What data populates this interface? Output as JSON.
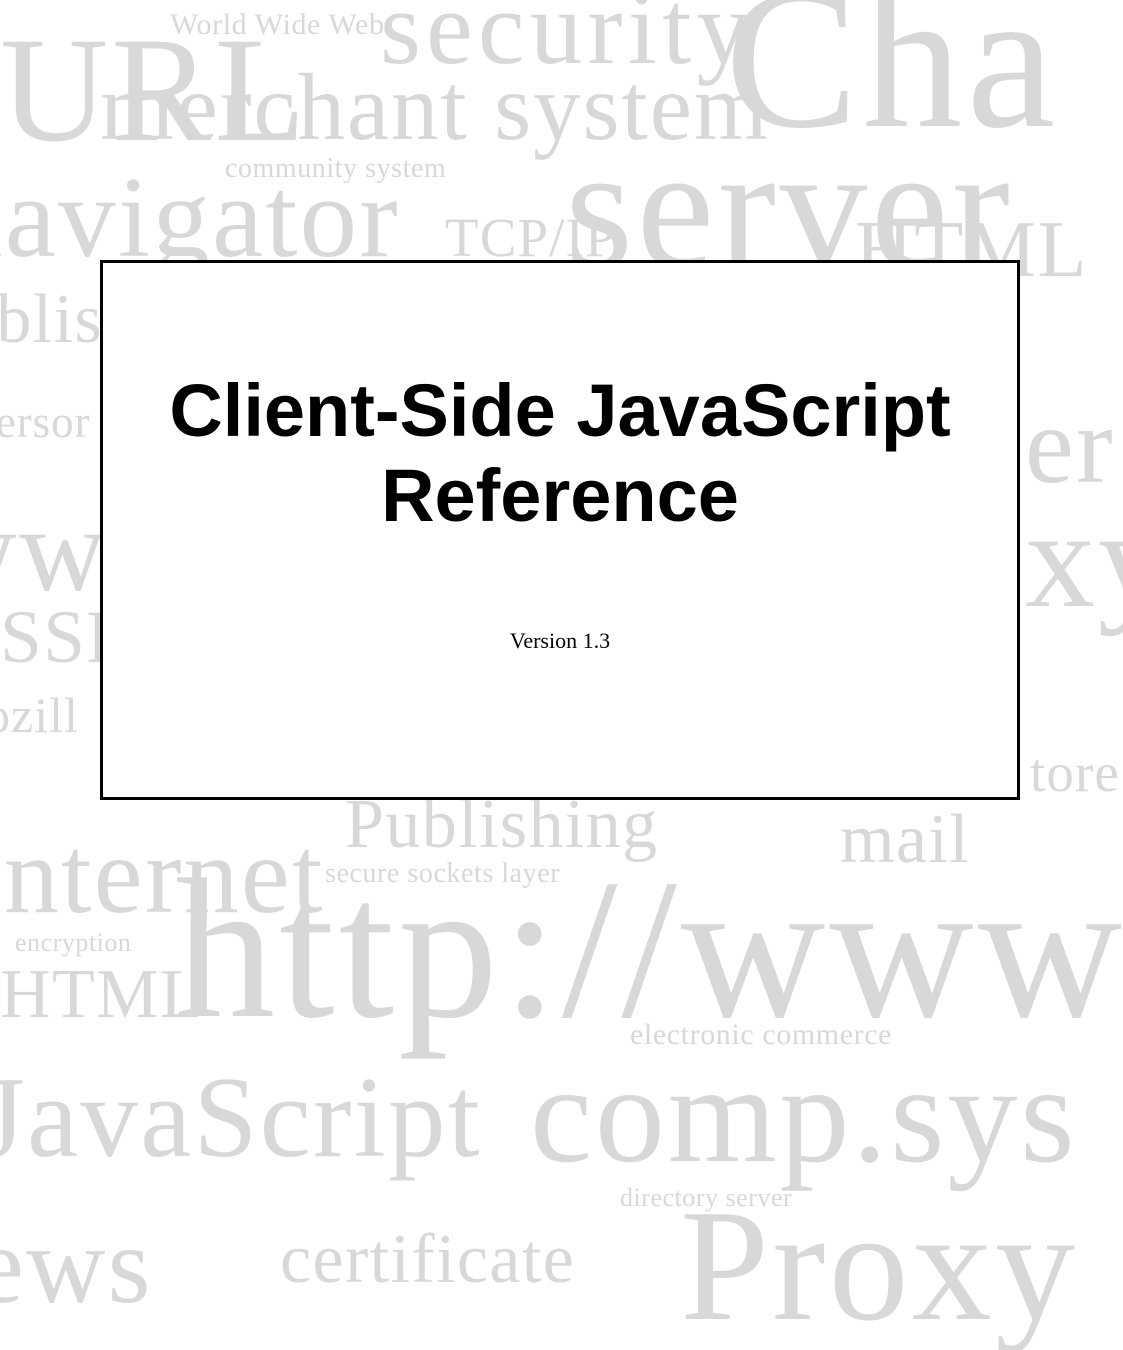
{
  "cover": {
    "title_line1": "Client-Side JavaScript",
    "title_line2": "Reference",
    "version": "Version 1.3"
  },
  "background_words": {
    "url": "URL",
    "world_wide_web": "World Wide Web",
    "security": "security",
    "cha": "Cha",
    "merchant_system": "merchant system",
    "community_system": "community system",
    "server": "server",
    "navigator": "navigator",
    "tcpip": "TCP/IP",
    "html_top": "HTML",
    "ublis": "ublis",
    "persor": "Persor",
    "er": "er",
    "ww_right": "ww",
    "ssl": "SSL",
    "xy": "xy",
    "ozill": "ozill",
    "tore": "tore",
    "publishing": "Publishing",
    "mail": "mail",
    "internet": "Internet",
    "secure_sockets": "secure sockets layer",
    "http_www": "http://www",
    "encryption": "encryption",
    "html_bottom": "HTML",
    "electronic_commerce": "electronic commerce",
    "javascript": "JavaScript",
    "comp_sys": "comp.sys",
    "directory_server": "directory server",
    "ews": "ews",
    "certificate": "certificate",
    "proxy": "Proxy"
  }
}
